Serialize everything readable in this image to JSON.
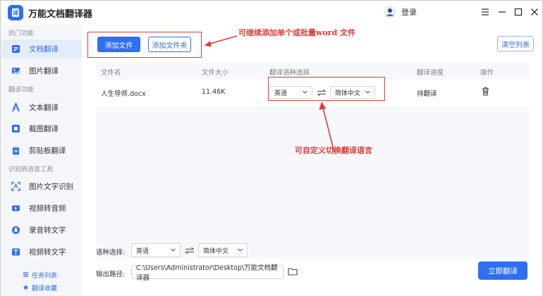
{
  "app": {
    "title": "万能文档翻译器",
    "login_label": "登录"
  },
  "window_controls": {
    "menu": "menu-icon",
    "minimize": "minimize-icon",
    "maximize": "maximize-icon",
    "close": "close-icon"
  },
  "sidebar": {
    "sections": [
      {
        "title": "热门功能"
      },
      {
        "title": "翻译功能"
      },
      {
        "title": "识别转语音工具"
      }
    ],
    "items": [
      {
        "label": "文档翻译",
        "icon": "document-icon",
        "active": true
      },
      {
        "label": "图片翻译",
        "icon": "image-icon"
      },
      {
        "label": "文本翻译",
        "icon": "text-icon"
      },
      {
        "label": "截图翻译",
        "icon": "screenshot-icon"
      },
      {
        "label": "剪贴板翻译",
        "icon": "clipboard-icon"
      },
      {
        "label": "图片文字识别",
        "icon": "ocr-icon"
      },
      {
        "label": "视频转音频",
        "icon": "video-icon"
      },
      {
        "label": "录音转文字",
        "icon": "microphone-icon"
      },
      {
        "label": "视频转文字",
        "icon": "video-text-icon"
      }
    ],
    "bottom_links": [
      {
        "label": "任务列表",
        "icon": "list-icon"
      },
      {
        "label": "翻译收藏",
        "icon": "star-icon"
      }
    ]
  },
  "toolbar": {
    "add_file": "添加文件",
    "add_folder": "添加文件夹",
    "clear_list": "清空列表"
  },
  "annotations": {
    "top": "可继续添加单个或批量word 文件",
    "middle": "可自定义切换翻译语言"
  },
  "table": {
    "headers": [
      "文件名",
      "文件大小",
      "翻译语种选择",
      "翻译进度",
      "操作"
    ],
    "rows": [
      {
        "file_name": "人生导师.docx",
        "size": "11.46K",
        "source_lang": "英语",
        "target_lang": "简体中文",
        "progress": "待翻译"
      }
    ]
  },
  "bottom": {
    "lang_label": "语种选择:",
    "source_lang": "英语",
    "target_lang": "简体中文",
    "output_label": "输出路径:",
    "output_path": "C:\\Users\\Administrator\\Desktop\\万能文档翻译器",
    "translate_button": "立即翻译"
  },
  "colors": {
    "accent": "#2f6ff0",
    "annotation": "#e53935"
  }
}
